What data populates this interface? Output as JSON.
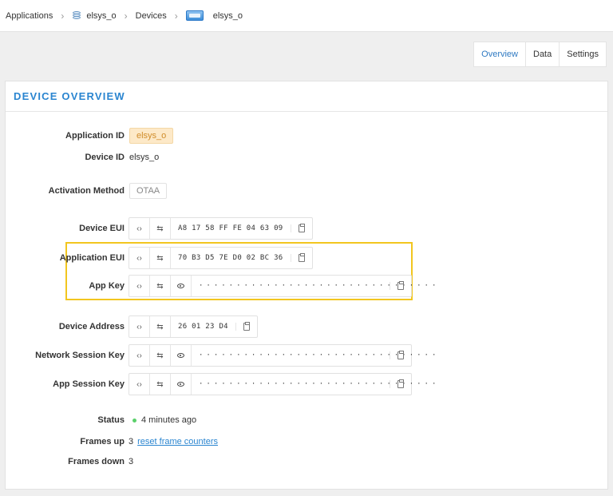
{
  "breadcrumb": {
    "applications": "Applications",
    "app": "elsys_o",
    "devices": "Devices",
    "device": "elsys_o"
  },
  "tabs": {
    "overview": "Overview",
    "data": "Data",
    "settings": "Settings"
  },
  "panel": {
    "title": "DEVICE OVERVIEW"
  },
  "fields": {
    "application_id_label": "Application ID",
    "application_id": "elsys_o",
    "device_id_label": "Device ID",
    "device_id": "elsys_o",
    "activation_method_label": "Activation Method",
    "activation_method": "OTAA",
    "device_eui_label": "Device EUI",
    "device_eui": "A8 17 58 FF FE 04 63 09",
    "application_eui_label": "Application EUI",
    "application_eui": "70 B3 D5 7E D0 02 BC 36",
    "app_key_label": "App Key",
    "app_key": "································",
    "device_address_label": "Device Address",
    "device_address": "26 01 23 D4",
    "network_session_key_label": "Network Session Key",
    "network_session_key": "································",
    "app_session_key_label": "App Session Key",
    "app_session_key": "································",
    "status_label": "Status",
    "status": "4 minutes ago",
    "frames_up_label": "Frames up",
    "frames_up": "3",
    "reset_link": "reset frame counters",
    "frames_down_label": "Frames down",
    "frames_down": "3"
  },
  "glyphs": {
    "code": "‹›",
    "swap": "⇆"
  },
  "colors": {
    "accent": "#2a85d0",
    "highlight": "#f2c61f",
    "status_dot": "#5bd06b"
  }
}
